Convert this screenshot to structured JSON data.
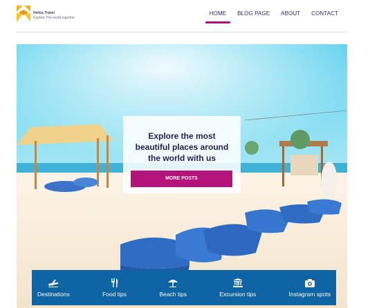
{
  "brand": {
    "name": "Helios Travel",
    "tagline": "Explore The world together"
  },
  "nav": {
    "items": [
      {
        "label": "HOME",
        "active": true
      },
      {
        "label": "BLOG PAGE",
        "active": false
      },
      {
        "label": "ABOUT",
        "active": false
      },
      {
        "label": "CONTACT",
        "active": false
      }
    ]
  },
  "hero": {
    "line1": "Explore the most",
    "line2": "beautiful places around",
    "line3": "the world with us",
    "button_label": "MORE POSTS"
  },
  "categories": [
    {
      "label": "Destinations",
      "icon": "plane-icon"
    },
    {
      "label": "Food tips",
      "icon": "cutlery-icon"
    },
    {
      "label": "Beach tips",
      "icon": "beach-umbrella-icon"
    },
    {
      "label": "Excursion tips",
      "icon": "museum-icon"
    },
    {
      "label": "Instagram spots",
      "icon": "camera-icon"
    }
  ],
  "colors": {
    "accent": "#b41479",
    "category_bar": "#0e63a3",
    "nav_text": "#2d2d6e"
  }
}
